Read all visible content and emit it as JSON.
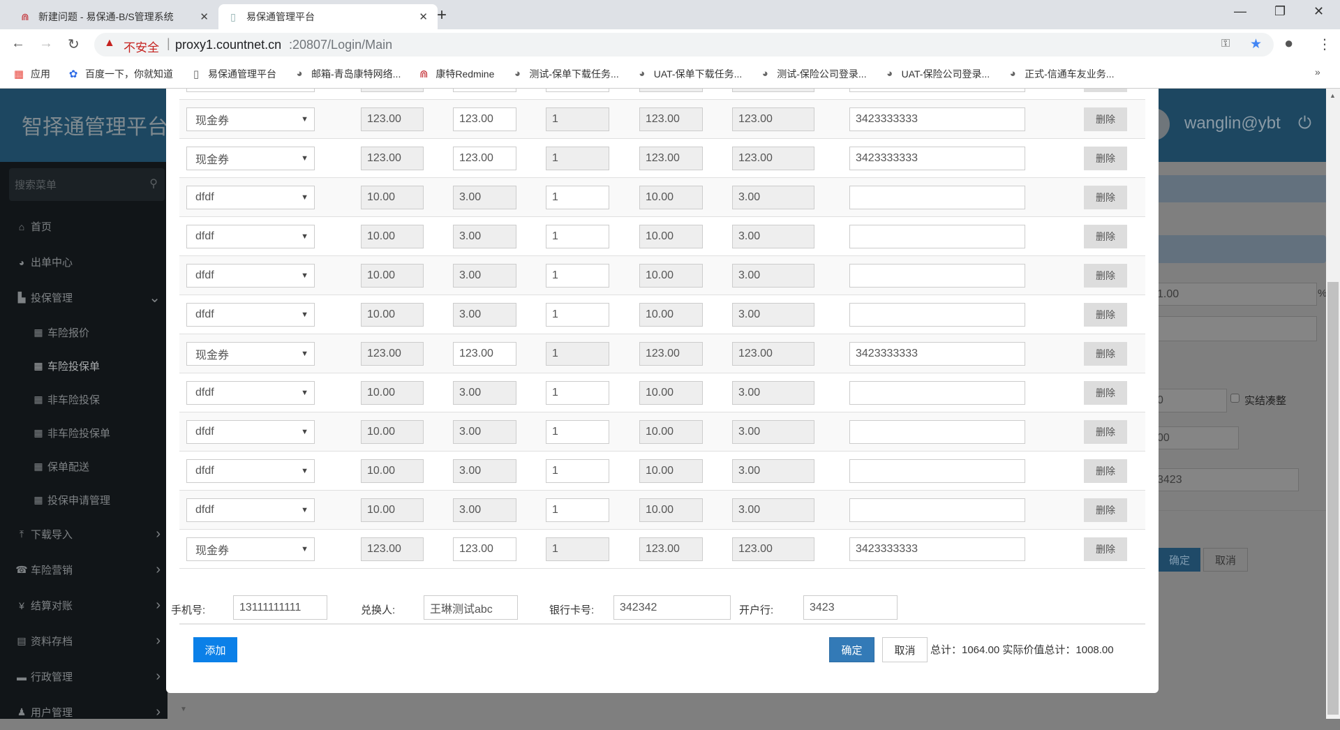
{
  "browser": {
    "tabs": [
      {
        "title": "新建问题 - 易保通-B/S管理系统",
        "active": false
      },
      {
        "title": "易保通管理平台",
        "active": true
      }
    ],
    "security_label": "不安全",
    "url_host": "proxy1.countnet.cn",
    "url_rest": ":20807/Login/Main",
    "bookmarks": [
      "应用",
      "百度一下，你就知道",
      "易保通管理平台",
      "邮箱-青岛康特网络...",
      "康特Redmine",
      "测试-保单下载任务...",
      "UAT-保单下载任务...",
      "测试-保险公司登录...",
      "UAT-保险公司登录...",
      "正式-信通车友业务..."
    ]
  },
  "sidebar": {
    "title": "智择通管理平台",
    "search_placeholder": "搜索菜单",
    "items": [
      {
        "label": "首页",
        "icon": "home-icon",
        "glyph": "⌂"
      },
      {
        "label": "出单中心",
        "icon": "globe-icon",
        "glyph": "◕"
      },
      {
        "label": "投保管理",
        "icon": "file-icon",
        "glyph": "▙",
        "expanded": true
      },
      {
        "label": "车险报价",
        "sub": true
      },
      {
        "label": "车险投保单",
        "sub": true,
        "current": true
      },
      {
        "label": "非车险投保",
        "sub": true
      },
      {
        "label": "非车险投保单",
        "sub": true
      },
      {
        "label": "保单配送",
        "sub": true
      },
      {
        "label": "投保申请管理",
        "sub": true
      },
      {
        "label": "下载导入",
        "icon": "upload-icon",
        "glyph": "⤒"
      },
      {
        "label": "车险营销",
        "icon": "phone-icon",
        "glyph": "☎"
      },
      {
        "label": "结算对账",
        "icon": "yen-icon",
        "glyph": "¥"
      },
      {
        "label": "资料存档",
        "icon": "list-icon",
        "glyph": "▤"
      },
      {
        "label": "行政管理",
        "icon": "folder-icon",
        "glyph": "▬"
      },
      {
        "label": "用户管理",
        "icon": "user-icon",
        "glyph": "♟"
      }
    ]
  },
  "header": {
    "user": "wanglin@ybt"
  },
  "background_form": {
    "rate_value": "1.00",
    "rate_unit": "%",
    "field_a": "0",
    "checkbox_label": "实结凑整",
    "field_b": "00",
    "field_c": "3423",
    "ok": "确定",
    "cancel": "取消"
  },
  "modal": {
    "rows": [
      {
        "type": "现金券",
        "v1": "123.00",
        "v2": "123.00",
        "qty": "1",
        "v3": "123.00",
        "v4": "123.00",
        "code": "3423333333",
        "kind": "cash"
      },
      {
        "type": "现金券",
        "v1": "123.00",
        "v2": "123.00",
        "qty": "1",
        "v3": "123.00",
        "v4": "123.00",
        "code": "3423333333",
        "kind": "cash"
      },
      {
        "type": "dfdf",
        "v1": "10.00",
        "v2": "3.00",
        "qty": "1",
        "v3": "10.00",
        "v4": "3.00",
        "code": "",
        "kind": "item"
      },
      {
        "type": "dfdf",
        "v1": "10.00",
        "v2": "3.00",
        "qty": "1",
        "v3": "10.00",
        "v4": "3.00",
        "code": "",
        "kind": "item"
      },
      {
        "type": "dfdf",
        "v1": "10.00",
        "v2": "3.00",
        "qty": "1",
        "v3": "10.00",
        "v4": "3.00",
        "code": "",
        "kind": "item"
      },
      {
        "type": "dfdf",
        "v1": "10.00",
        "v2": "3.00",
        "qty": "1",
        "v3": "10.00",
        "v4": "3.00",
        "code": "",
        "kind": "item"
      },
      {
        "type": "现金券",
        "v1": "123.00",
        "v2": "123.00",
        "qty": "1",
        "v3": "123.00",
        "v4": "123.00",
        "code": "3423333333",
        "kind": "cash"
      },
      {
        "type": "dfdf",
        "v1": "10.00",
        "v2": "3.00",
        "qty": "1",
        "v3": "10.00",
        "v4": "3.00",
        "code": "",
        "kind": "item"
      },
      {
        "type": "dfdf",
        "v1": "10.00",
        "v2": "3.00",
        "qty": "1",
        "v3": "10.00",
        "v4": "3.00",
        "code": "",
        "kind": "item"
      },
      {
        "type": "dfdf",
        "v1": "10.00",
        "v2": "3.00",
        "qty": "1",
        "v3": "10.00",
        "v4": "3.00",
        "code": "",
        "kind": "item"
      },
      {
        "type": "dfdf",
        "v1": "10.00",
        "v2": "3.00",
        "qty": "1",
        "v3": "10.00",
        "v4": "3.00",
        "code": "",
        "kind": "item"
      },
      {
        "type": "现金券",
        "v1": "123.00",
        "v2": "123.00",
        "qty": "1",
        "v3": "123.00",
        "v4": "123.00",
        "code": "3423333333",
        "kind": "cash"
      }
    ],
    "delete_label": "删除",
    "phone_label": "手机号:",
    "phone": "13111111111",
    "redeemer_label": "兑换人:",
    "redeemer": "王琳测试abc",
    "card_label": "银行卡号:",
    "card": "342342",
    "bank_label": "开户行:",
    "bank": "3423",
    "add": "添加",
    "ok": "确定",
    "cancel": "取消",
    "totals": "总计：1064.00 实际价值总计：1008.00"
  }
}
